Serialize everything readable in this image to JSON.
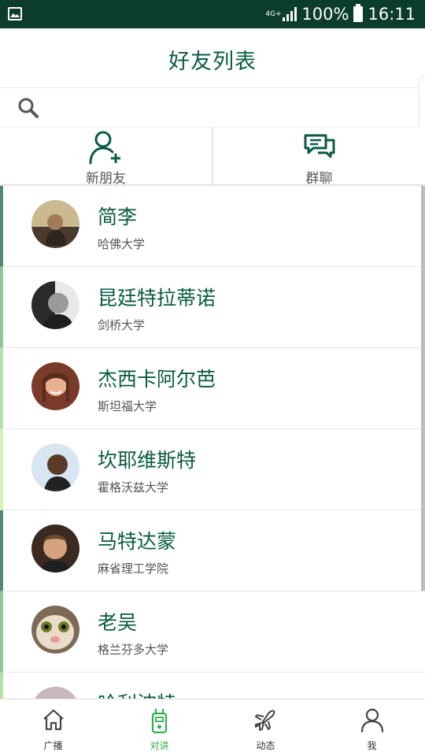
{
  "status_bar": {
    "network_label": "4G+",
    "battery": "100%",
    "time": "16:11"
  },
  "header": {
    "title": "好友列表"
  },
  "search": {
    "placeholder": ""
  },
  "quick_actions": [
    {
      "label": "新朋友",
      "icon": "add-friend-icon"
    },
    {
      "label": "群聊",
      "icon": "group-chat-icon"
    }
  ],
  "friends": [
    {
      "name": "简李",
      "school": "哈佛大学",
      "bar_color": "#4f8a78"
    },
    {
      "name": "昆廷特拉蒂诺",
      "school": "剑桥大学",
      "bar_color": "#8cc79a"
    },
    {
      "name": "杰西卡阿尔芭",
      "school": "斯坦福大学",
      "bar_color": "#b3dfa8"
    },
    {
      "name": "坎耶维斯特",
      "school": "霍格沃兹大学",
      "bar_color": "#d6f0b4"
    },
    {
      "name": "马特达蒙",
      "school": "麻省理工学院",
      "bar_color": "#4f8a78"
    },
    {
      "name": "老吴",
      "school": "格兰芬多大学",
      "bar_color": "#8cc79a"
    },
    {
      "name": "哈利波特",
      "school": "",
      "bar_color": "#b3dfa8"
    }
  ],
  "bottom_nav": [
    {
      "label": "广播",
      "icon": "home-icon",
      "active": false
    },
    {
      "label": "对讲",
      "icon": "walkie-talkie-icon",
      "active": true
    },
    {
      "label": "动态",
      "icon": "airplane-icon",
      "active": false
    },
    {
      "label": "我",
      "icon": "person-icon",
      "active": false
    }
  ],
  "colors": {
    "brand": "#0a5b46",
    "status_bar": "#0c3d2c",
    "active_nav": "#2fb24a"
  }
}
